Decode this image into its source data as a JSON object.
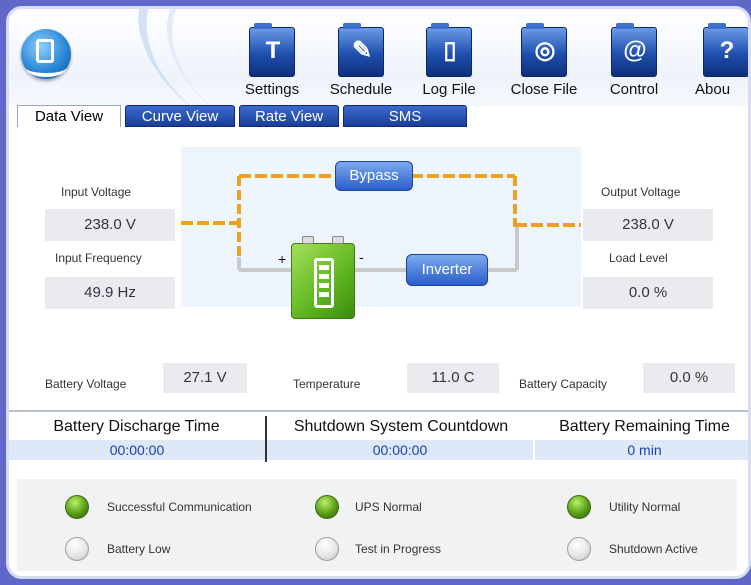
{
  "toolbar": {
    "items": [
      {
        "label": "Settings",
        "icon": "settings-icon",
        "glyph": "T"
      },
      {
        "label": "Schedule",
        "icon": "schedule-icon",
        "glyph": "✎"
      },
      {
        "label": "Log File",
        "icon": "log-file-icon",
        "glyph": "▯"
      },
      {
        "label": "Close File",
        "icon": "close-file-icon",
        "glyph": "◎"
      },
      {
        "label": "Control",
        "icon": "control-icon",
        "glyph": "@"
      },
      {
        "label": "Abou",
        "icon": "about-icon",
        "glyph": "?"
      }
    ]
  },
  "tabs": [
    {
      "label": "Data View",
      "active": true
    },
    {
      "label": "Curve View",
      "active": false
    },
    {
      "label": "Rate View",
      "active": false
    },
    {
      "label": "SMS",
      "active": false
    }
  ],
  "diagram": {
    "input_voltage_label": "Input Voltage",
    "input_voltage_value": "238.0 V",
    "input_frequency_label": "Input Frequency",
    "input_frequency_value": "49.9 Hz",
    "output_voltage_label": "Output Voltage",
    "output_voltage_value": "238.0 V",
    "load_level_label": "Load Level",
    "load_level_value": "0.0 %",
    "bypass_label": "Bypass",
    "inverter_label": "Inverter",
    "plus": "+",
    "minus": "-"
  },
  "readings": {
    "battery_voltage_label": "Battery Voltage",
    "battery_voltage_value": "27.1 V",
    "temperature_label": "Temperature",
    "temperature_value": "11.0 C",
    "battery_capacity_label": "Battery Capacity",
    "battery_capacity_value": "0.0 %"
  },
  "times": {
    "headers": [
      "Battery Discharge Time",
      "Shutdown System Countdown",
      "Battery Remaining Time"
    ],
    "values": [
      "00:00:00",
      "00:00:00",
      "0 min"
    ]
  },
  "status": [
    {
      "label": "Successful Communication",
      "on": true
    },
    {
      "label": "UPS Normal",
      "on": true
    },
    {
      "label": "Utility Normal",
      "on": true
    },
    {
      "label": "Battery Low",
      "on": false
    },
    {
      "label": "Test in Progress",
      "on": false
    },
    {
      "label": "Shutdown Active",
      "on": false
    }
  ],
  "colors": {
    "accent_blue": "#2a5ec9",
    "bypass_line": "#f0a020",
    "led_on": "#5a9d16",
    "value_text": "#1a3fae"
  }
}
